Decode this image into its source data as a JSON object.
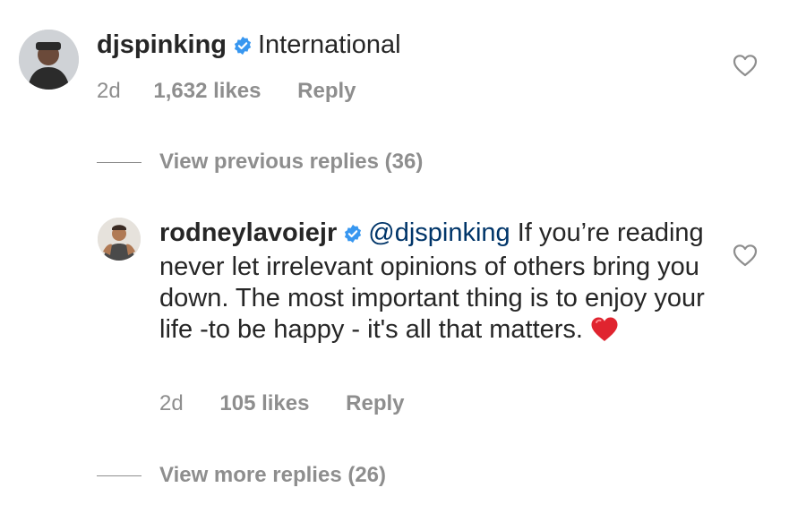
{
  "comment1": {
    "username": "djspinking",
    "text": "International",
    "time": "2d",
    "likes": "1,632 likes",
    "reply_label": "Reply"
  },
  "view_previous": "View previous replies (36)",
  "reply1": {
    "username": "rodneylavoiejr",
    "mention": "@djspinking",
    "text": " If you’re reading never let irrelevant opinions of others bring you down. The most important thing is to enjoy your life -to be happy - it's all that matters. ",
    "emoji": "red-heart",
    "time": "2d",
    "likes": "105 likes",
    "reply_label": "Reply"
  },
  "view_more": "View more replies (26)",
  "icons": {
    "verified": "verified-badge-icon",
    "like": "heart-outline-icon"
  },
  "colors": {
    "verified_blue": "#3897f0",
    "meta_gray": "#8e8e8e",
    "mention_blue": "#003569",
    "emoji_red": "#e0242f"
  }
}
